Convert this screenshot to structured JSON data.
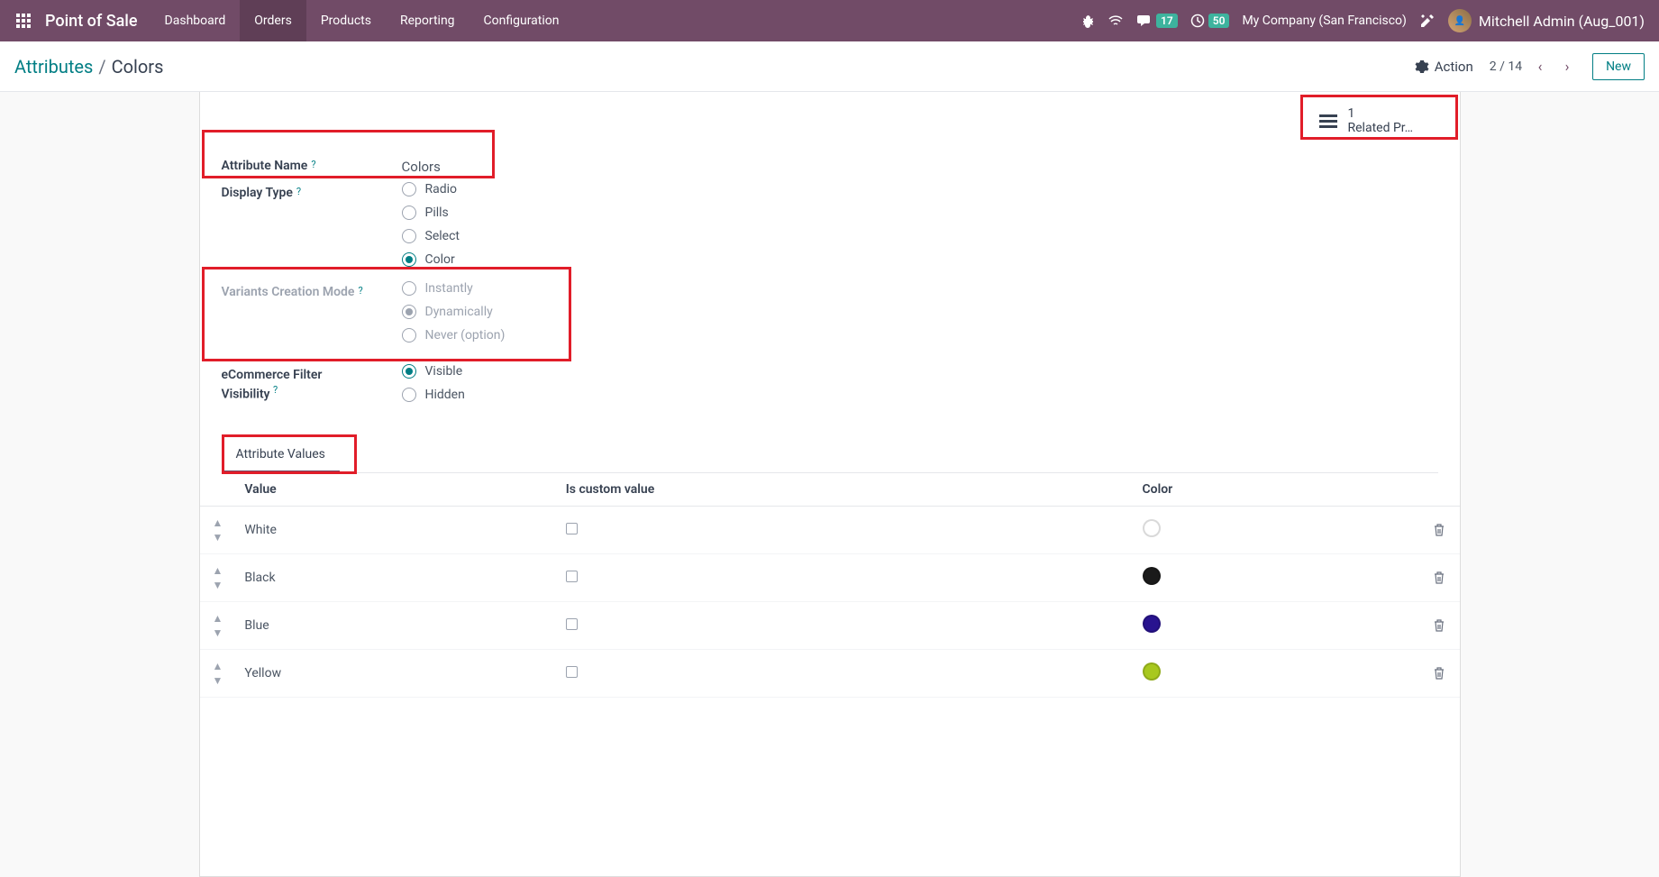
{
  "topnav": {
    "brand": "Point of Sale",
    "items": [
      "Dashboard",
      "Orders",
      "Products",
      "Reporting",
      "Configuration"
    ],
    "active_index": 1,
    "chat_badge": "17",
    "activity_badge": "50",
    "company": "My Company (San Francisco)",
    "user": "Mitchell Admin (Aug_001)"
  },
  "breadcrumb": {
    "parent": "Attributes",
    "current": "Colors"
  },
  "controls": {
    "action_label": "Action",
    "pager": "2 / 14",
    "new_label": "New"
  },
  "stat": {
    "count": "1",
    "label": "Related Pr…"
  },
  "form": {
    "attr_name_label": "Attribute Name",
    "attr_name_value": "Colors",
    "display_type_label": "Display Type",
    "display_type_options": [
      "Radio",
      "Pills",
      "Select",
      "Color"
    ],
    "display_type_selected": 3,
    "variants_label": "Variants Creation Mode",
    "variants_options": [
      "Instantly",
      "Dynamically",
      "Never (option)"
    ],
    "variants_selected": 1,
    "ecom_label_1": "eCommerce Filter",
    "ecom_label_2": "Visibility",
    "ecom_options": [
      "Visible",
      "Hidden"
    ],
    "ecom_selected": 0
  },
  "tab_label": "Attribute Values",
  "table": {
    "headers": [
      "Value",
      "Is custom value",
      "Color"
    ],
    "rows": [
      {
        "value": "White",
        "is_custom": false,
        "color": "#ffffff"
      },
      {
        "value": "Black",
        "is_custom": false,
        "color": "#1a1a1a"
      },
      {
        "value": "Blue",
        "is_custom": false,
        "color": "#28138f"
      },
      {
        "value": "Yellow",
        "is_custom": false,
        "color": "#a8c81e"
      }
    ]
  }
}
